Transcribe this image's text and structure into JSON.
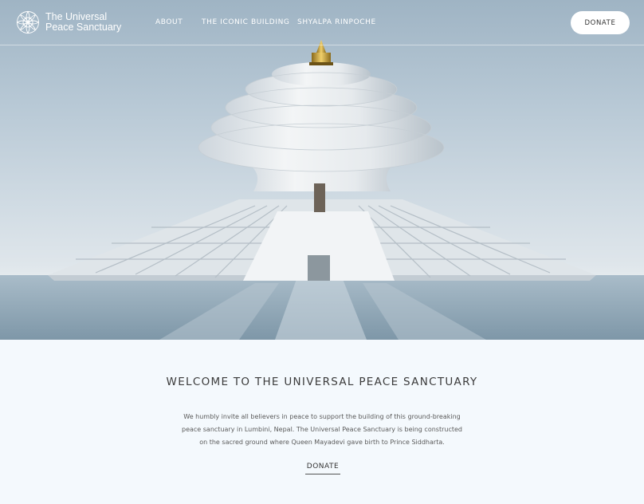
{
  "brand": {
    "line1": "The Universal",
    "line2": "Peace Sanctuary",
    "logo_icon": "lotus-mandala-icon"
  },
  "nav": {
    "items": [
      {
        "label": "ABOUT"
      },
      {
        "label": "THE ICONIC BUILDING"
      },
      {
        "label": "SHYALPA RINPOCHE"
      }
    ],
    "donate_label": "DONATE"
  },
  "hero": {
    "image": "Rendering of a white spiral temple building on water",
    "colors": {
      "sky_top": "#9fb4c4",
      "building": "#eef1f3",
      "finial": "#c9a23a"
    }
  },
  "welcome": {
    "title": "WELCOME TO THE UNIVERSAL PEACE SANCTUARY",
    "text": "We humbly invite all believers in peace to support the building of this ground-breaking peace sanctuary in Lumbini, Nepal. The Universal Peace Sanctuary is being constructed on the sacred ground where Queen Mayadevi gave birth to Prince Siddharta.",
    "donate_label": "DONATE"
  }
}
